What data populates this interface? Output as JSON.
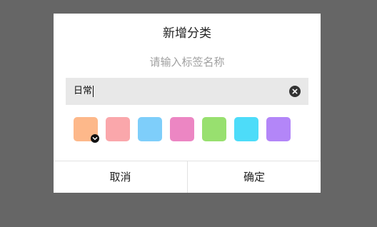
{
  "dialog": {
    "title": "新增分类",
    "subtitle": "请输入标签名称",
    "input": {
      "value": "日常"
    },
    "clear_icon": "clear-circle-icon",
    "colors": [
      {
        "hex": "#FDB88A",
        "selected": true
      },
      {
        "hex": "#FAA7AB",
        "selected": false
      },
      {
        "hex": "#7ECEFA",
        "selected": false
      },
      {
        "hex": "#EC86C3",
        "selected": false
      },
      {
        "hex": "#98E06F",
        "selected": false
      },
      {
        "hex": "#4DDCF9",
        "selected": false
      },
      {
        "hex": "#B386F8",
        "selected": false
      }
    ],
    "selected_icon": "checkmark-icon",
    "cancel_label": "取消",
    "confirm_label": "确定"
  },
  "colors": {
    "overlay": "#666666",
    "dialog_bg": "#FFFFFF",
    "input_bg": "#E8E8E8"
  }
}
